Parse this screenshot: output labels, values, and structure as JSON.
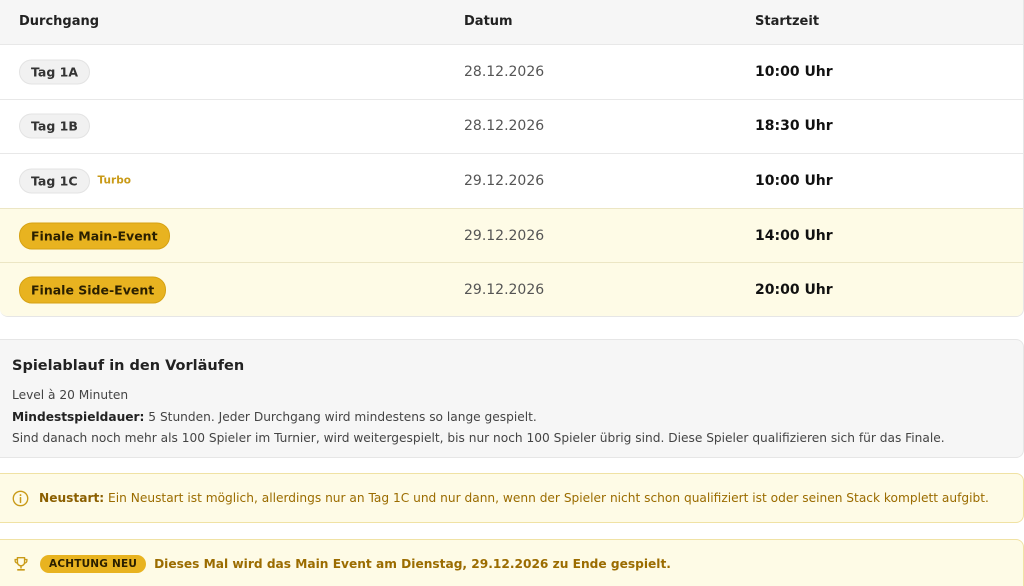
{
  "schedule": {
    "headers": {
      "round": "Durchgang",
      "date": "Datum",
      "start": "Startzeit"
    },
    "rows": [
      {
        "round": "Tag 1A",
        "tag": "",
        "date": "28.12.2026",
        "time": "10:00 Uhr"
      },
      {
        "round": "Tag 1B",
        "tag": "",
        "date": "28.12.2026",
        "time": "18:30 Uhr"
      },
      {
        "round": "Tag 1C",
        "tag": "Turbo",
        "date": "29.12.2026",
        "time": "10:00 Uhr"
      },
      {
        "round": "Finale Main-Event",
        "tag": "",
        "date": "29.12.2026",
        "time": "14:00 Uhr"
      },
      {
        "round": "Finale Side-Event",
        "tag": "",
        "date": "29.12.2026",
        "time": "20:00 Uhr"
      }
    ]
  },
  "info": {
    "title": "Spielablauf in den Vorläufen",
    "line1": "Level à 20 Minuten",
    "line2_label": "Mindestspieldauer:",
    "line2_text": " 5 Stunden. Jeder Durchgang wird mindestens so lange gespielt.",
    "line3": "Sind danach noch mehr als 100 Spieler im Turnier, wird weitergespielt, bis nur noch 100 Spieler übrig sind. Diese Spieler qualifizieren sich für das Finale."
  },
  "notice": {
    "icon": "info-circle-icon",
    "label": "Neustart:",
    "text": " Ein Neustart ist möglich, allerdings nur an Tag 1C und nur dann, wenn der Spieler nicht schon qualifiziert ist oder seinen Stack komplett aufgibt."
  },
  "alert": {
    "icon": "trophy-icon",
    "badge": "ACHTUNG NEU",
    "text": "Dieses Mal wird das Main Event am Dienstag, 29.12.2026 zu Ende gespielt."
  },
  "colors": {
    "accent": "#e8b320",
    "highlight_bg": "#fefbe6",
    "notice_text": "#9b6c00"
  }
}
